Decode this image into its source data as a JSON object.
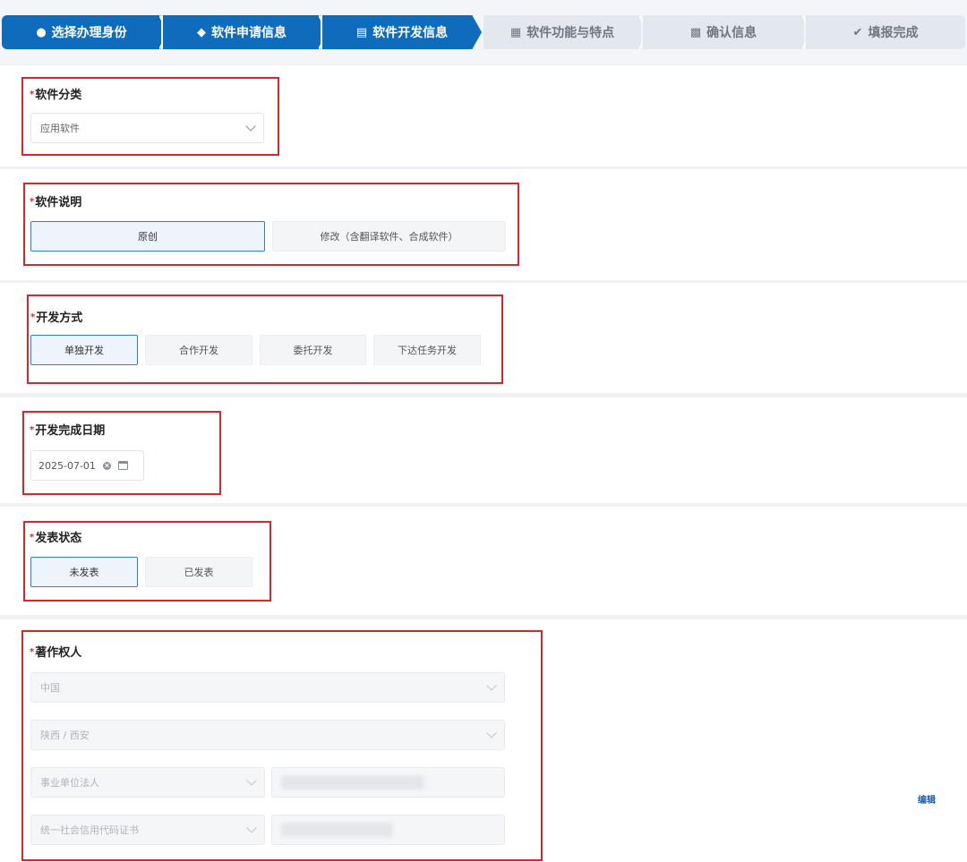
{
  "stepper": {
    "steps": [
      {
        "label": "选择办理身份",
        "icon": "user-icon",
        "state": "done"
      },
      {
        "label": "软件申请信息",
        "icon": "location-pin-icon",
        "state": "done"
      },
      {
        "label": "软件开发信息",
        "icon": "keyboard-icon",
        "state": "current"
      },
      {
        "label": "软件功能与特点",
        "icon": "document-icon",
        "state": "pending"
      },
      {
        "label": "确认信息",
        "icon": "clipboard-icon",
        "state": "pending"
      },
      {
        "label": "填报完成",
        "icon": "check-circle-icon",
        "state": "pending"
      }
    ],
    "active_color": "#0f6cbd"
  },
  "software_category": {
    "label": "软件分类",
    "value": "应用软件"
  },
  "software_description": {
    "label": "软件说明",
    "options": [
      "原创",
      "修改（含翻译软件、合成软件）"
    ],
    "selected": "原创"
  },
  "development_method": {
    "label": "开发方式",
    "options": [
      "单独开发",
      "合作开发",
      "委托开发",
      "下达任务开发"
    ],
    "selected": "单独开发"
  },
  "completion_date": {
    "label": "开发完成日期",
    "value": "2025-07-01"
  },
  "publish_status": {
    "label": "发表状态",
    "options": [
      "未发表",
      "已发表"
    ],
    "selected": "未发表"
  },
  "copyright_owner": {
    "label": "著作权人",
    "country": "中国",
    "region": "陕西 / 西安",
    "owner_type": "事业单位法人",
    "id_type": "统一社会信用代码证书",
    "edit_label": "编辑"
  },
  "colors": {
    "required": "#e0262c",
    "highlight_box": "#d8262c",
    "selected_border": "#2f7fd0"
  }
}
